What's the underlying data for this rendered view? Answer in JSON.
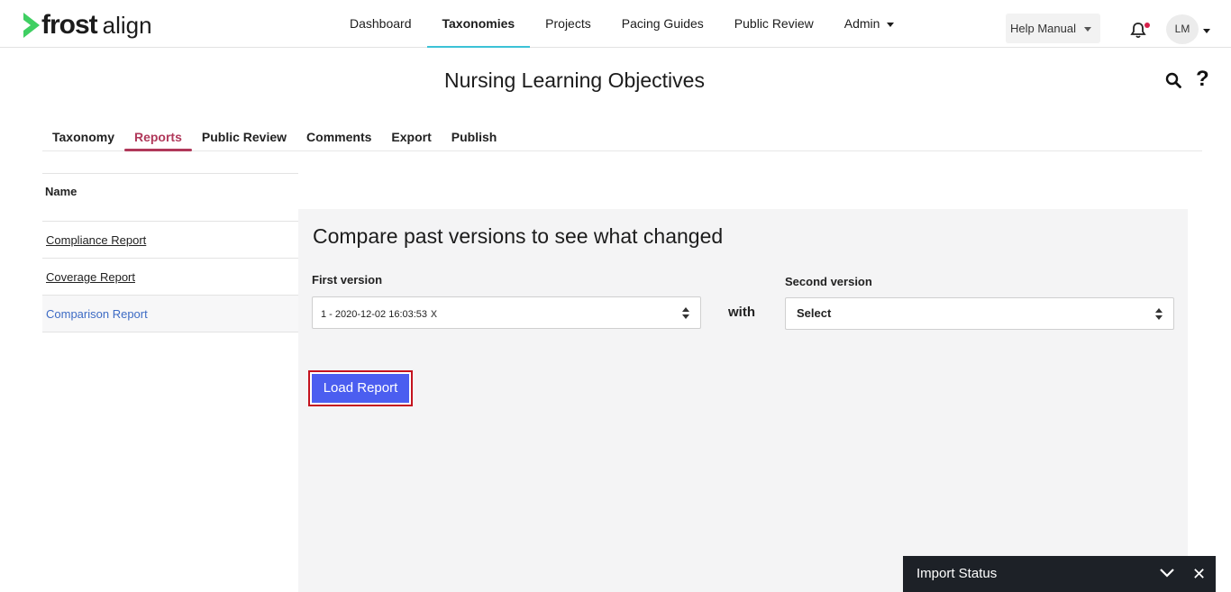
{
  "brand": {
    "name_bold": "frost",
    "name_light": "align"
  },
  "nav": {
    "items": [
      {
        "label": "Dashboard"
      },
      {
        "label": "Taxonomies",
        "active": true
      },
      {
        "label": "Projects"
      },
      {
        "label": "Pacing Guides"
      },
      {
        "label": "Public Review"
      },
      {
        "label": "Admin",
        "has_dropdown": true
      }
    ]
  },
  "header": {
    "help_label": "Help Manual",
    "avatar_initials": "LM"
  },
  "page": {
    "title": "Nursing Learning Objectives"
  },
  "tabs": [
    {
      "label": "Taxonomy"
    },
    {
      "label": "Reports",
      "active": true
    },
    {
      "label": "Public Review"
    },
    {
      "label": "Comments"
    },
    {
      "label": "Export"
    },
    {
      "label": "Publish"
    }
  ],
  "reports": {
    "header": "Name",
    "items": [
      {
        "label": "Compliance Report"
      },
      {
        "label": "Coverage Report"
      },
      {
        "label": "Comparison Report",
        "selected": true
      }
    ]
  },
  "compare": {
    "heading": "Compare past versions to see what changed",
    "first_label": "First version",
    "first_value": "1 - 2020-12-02 16:03:53",
    "clear": "x",
    "with_label": "with",
    "second_label": "Second version",
    "second_value": "Select",
    "load_button": "Load Report"
  },
  "import_status": {
    "label": "Import Status"
  },
  "colors": {
    "accent_tab": "#b0385a",
    "nav_underline": "#3cc2d6",
    "button": "#4b5ef0",
    "highlight_border": "#c4131f",
    "link_selected": "#3d6bc4"
  }
}
